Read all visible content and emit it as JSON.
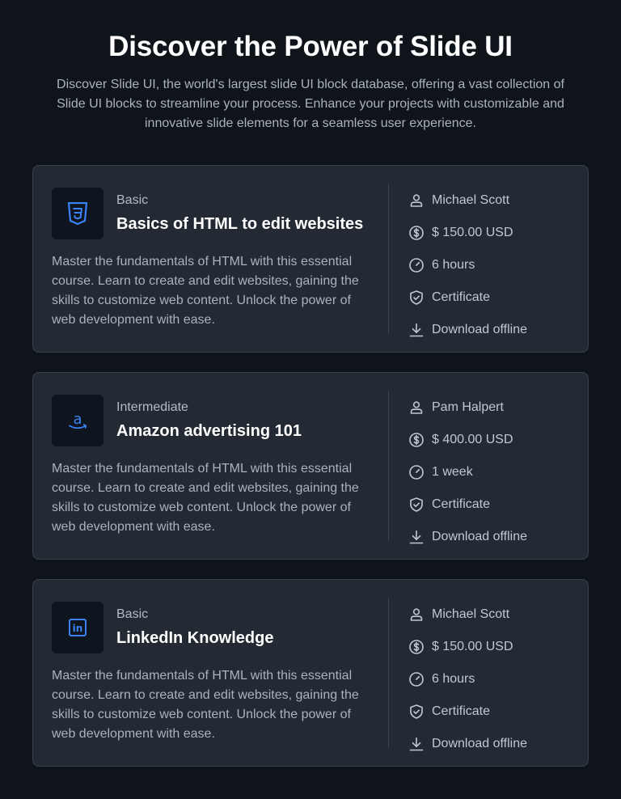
{
  "header": {
    "title": "Discover the Power of Slide UI",
    "subtitle": "Discover Slide UI, the world's largest slide UI block database, offering a vast collection of Slide UI blocks to streamline your process. Enhance your projects with customizable and innovative slide elements for a seamless user experience."
  },
  "colors": {
    "background": "#0f131a",
    "card": "#232a33",
    "accent_blue": "#3b82f6"
  },
  "courses": [
    {
      "logo_icon": "css3-shield-icon",
      "level": "Basic",
      "title": "Basics of HTML to edit websites",
      "description": "Master the fundamentals of HTML with this essential course. Learn to create and edit websites, gaining the skills to customize web content. Unlock the power of web development with ease.",
      "instructor": "Michael Scott",
      "price": "$ 150.00 USD",
      "duration": "6 hours",
      "certificate": "Certificate",
      "download": "Download offline"
    },
    {
      "logo_icon": "amazon-logo-icon",
      "level": "Intermediate",
      "title": "Amazon advertising 101",
      "description": "Master the fundamentals of HTML with this essential course. Learn to create and edit websites, gaining the skills to customize web content. Unlock the power of web development with ease.",
      "instructor": "Pam Halpert",
      "price": "$ 400.00 USD",
      "duration": "1 week",
      "certificate": "Certificate",
      "download": "Download offline"
    },
    {
      "logo_icon": "linkedin-logo-icon",
      "level": "Basic",
      "title": "LinkedIn Knowledge",
      "description": "Master the fundamentals of HTML with this essential course. Learn to create and edit websites, gaining the skills to customize web content. Unlock the power of web development with ease.",
      "instructor": "Michael Scott",
      "price": "$ 150.00 USD",
      "duration": "6 hours",
      "certificate": "Certificate",
      "download": "Download offline"
    }
  ]
}
